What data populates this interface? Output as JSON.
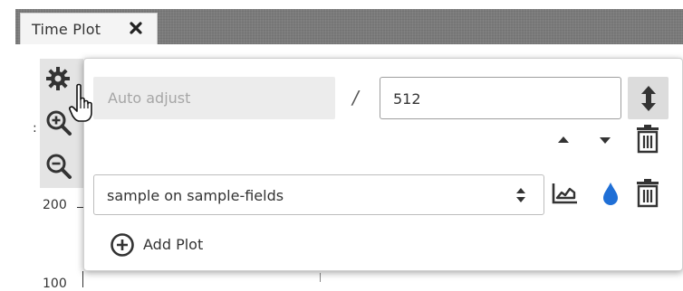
{
  "tab": {
    "title": "Time Plot"
  },
  "axis": {
    "y_ticks": [
      "200",
      "100"
    ]
  },
  "popup": {
    "range_mode_placeholder": "Auto adjust",
    "separator": "/",
    "buffer_size": "512",
    "source_select_value": "sample on sample-fields",
    "add_plot_label": "Add Plot"
  },
  "icons": {
    "tab_close": "close-icon",
    "settings": "gear-icon",
    "zoom_in": "zoom-in-icon",
    "zoom_out": "zoom-out-icon",
    "updown": "arrows-vertical-icon",
    "move_up": "caret-up-icon",
    "move_down": "caret-down-icon",
    "delete": "trash-icon",
    "select_caret": "sort-caret-icon",
    "chart_style": "line-chart-icon",
    "color": "droplet-icon",
    "add": "plus-circle-icon",
    "cursor": "hand-pointer-icon"
  },
  "colors": {
    "tabstrip": "#7a7a7a",
    "droplet": "#1f6fd6",
    "icon_dark": "#333333",
    "toolbar_bg": "#e4e4e4"
  }
}
